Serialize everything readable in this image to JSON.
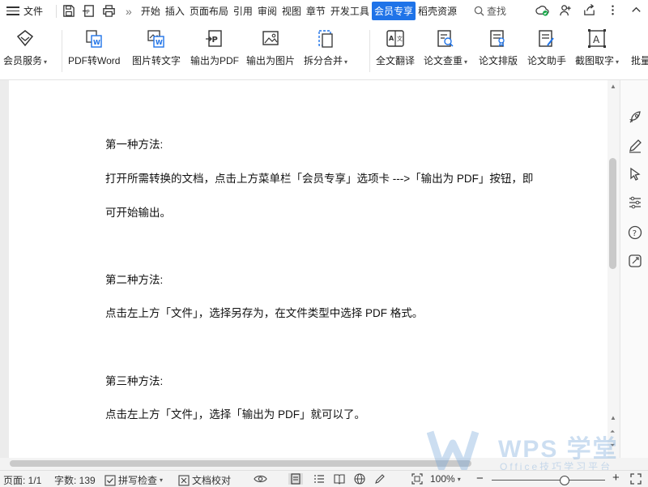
{
  "menu": {
    "file_label": "文件",
    "tabs": [
      {
        "label": "开始",
        "active": false
      },
      {
        "label": "插入",
        "active": false
      },
      {
        "label": "页面布局",
        "active": false
      },
      {
        "label": "引用",
        "active": false
      },
      {
        "label": "审阅",
        "active": false
      },
      {
        "label": "视图",
        "active": false
      },
      {
        "label": "章节",
        "active": false
      },
      {
        "label": "开发工具",
        "active": false
      },
      {
        "label": "会员专享",
        "active": true
      },
      {
        "label": "稻壳资源",
        "active": false
      }
    ],
    "more_glyph": "»",
    "search_label": "查找",
    "accent_color": "#1f73e8"
  },
  "toolbar": {
    "items": [
      {
        "label": "会员服务",
        "icon": "diamond-icon"
      },
      {
        "label": "PDF转Word",
        "icon": "pdf-to-word-icon"
      },
      {
        "label": "图片转文字",
        "icon": "image-to-text-icon"
      },
      {
        "label": "输出为PDF",
        "icon": "export-pdf-icon"
      },
      {
        "label": "输出为图片",
        "icon": "export-image-icon"
      },
      {
        "label": "拆分合并",
        "icon": "split-merge-icon"
      },
      {
        "label": "全文翻译",
        "icon": "translate-icon"
      },
      {
        "label": "论文查重",
        "icon": "plagiarism-check-icon"
      },
      {
        "label": "论文排版",
        "icon": "paper-layout-icon"
      },
      {
        "label": "论文助手",
        "icon": "paper-assistant-icon"
      },
      {
        "label": "截图取字",
        "icon": "screenshot-ocr-icon"
      },
      {
        "label": "批量",
        "icon": "batch-icon"
      }
    ]
  },
  "document": {
    "paragraphs": [
      "第一种方法:",
      "打开所需转换的文档，点击上方菜单栏「会员专享」选项卡 --->「输出为 PDF」按钮，即",
      "可开始输出。",
      "第二种方法:",
      "点击左上方「文件」，选择另存为，在文件类型中选择 PDF 格式。",
      "第三种方法:",
      "点击左上方「文件」，选择「输出为 PDF」就可以了。"
    ]
  },
  "statusbar": {
    "page": "页面: 1/1",
    "words": "字数: 139",
    "spellcheck": "拼写检查",
    "proofread": "文档校对",
    "zoom": "100%",
    "zoom_level": 1.0
  },
  "watermark": {
    "brand": "WPS 学堂",
    "tagline": "Office技巧学习平台"
  }
}
